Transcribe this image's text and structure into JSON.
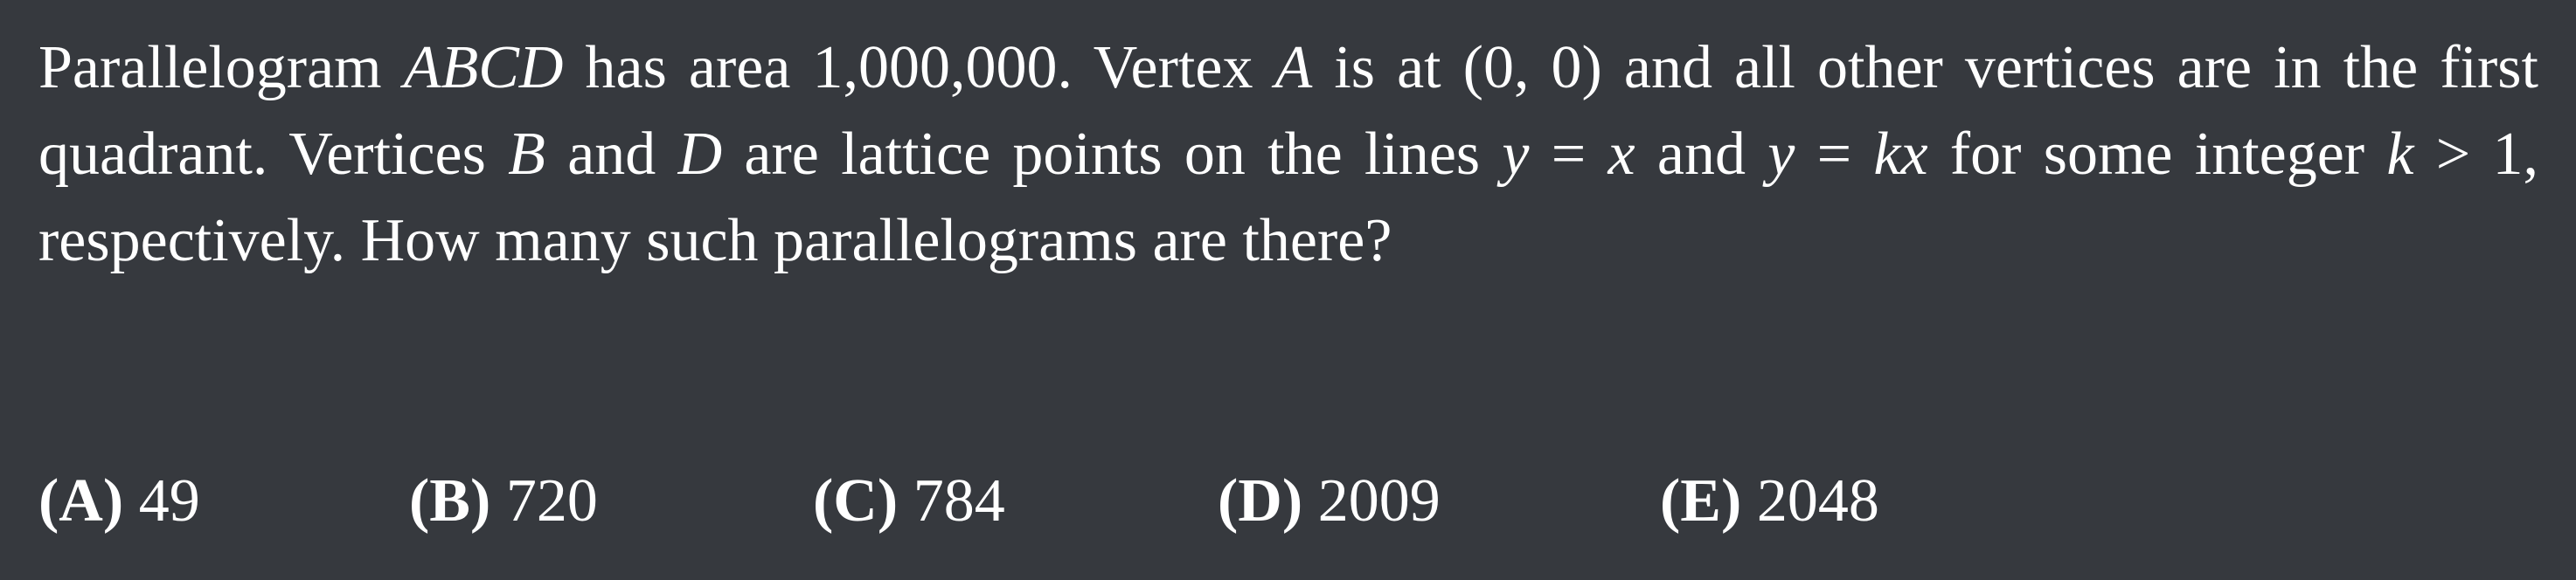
{
  "problem": {
    "segments": [
      {
        "text": "Parallelogram ",
        "math": false
      },
      {
        "text": "ABCD",
        "math": true
      },
      {
        "text": " has area 1,000,000.  Vertex ",
        "math": false
      },
      {
        "text": "A",
        "math": true
      },
      {
        "text": " is at (0, 0) and all other vertices are in the first quadrant.  Vertices ",
        "math": false
      },
      {
        "text": "B",
        "math": true
      },
      {
        "text": " and ",
        "math": false
      },
      {
        "text": "D",
        "math": true
      },
      {
        "text": " are lattice points on the lines ",
        "math": false
      },
      {
        "text": "y",
        "math": true
      },
      {
        "text": " = ",
        "math": false
      },
      {
        "text": "x",
        "math": true
      },
      {
        "text": " and ",
        "math": false
      },
      {
        "text": "y",
        "math": true
      },
      {
        "text": " = ",
        "math": false
      },
      {
        "text": "kx",
        "math": true
      },
      {
        "text": " for some integer ",
        "math": false
      },
      {
        "text": "k",
        "math": true
      },
      {
        "text": " > 1, respectively.  How many such parallelograms are there?",
        "math": false
      }
    ]
  },
  "choices": [
    {
      "label": "(A)",
      "value": "49"
    },
    {
      "label": "(B)",
      "value": "720"
    },
    {
      "label": "(C)",
      "value": "784"
    },
    {
      "label": "(D)",
      "value": "2009"
    },
    {
      "label": "(E)",
      "value": "2048"
    }
  ]
}
